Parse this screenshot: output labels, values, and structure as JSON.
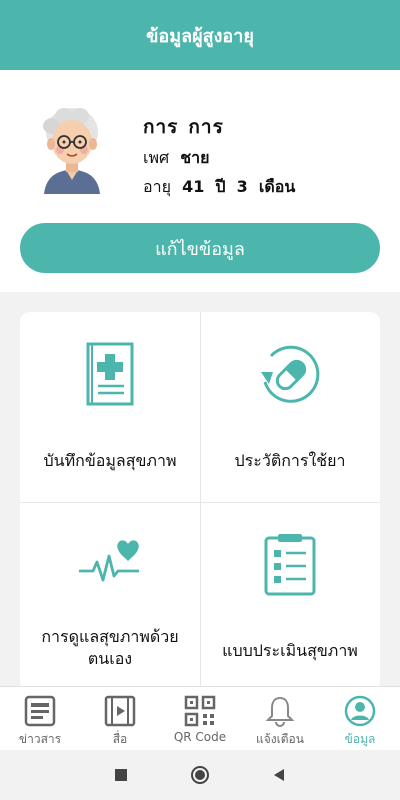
{
  "header": {
    "title": "ข้อมูลผู้สูงอายุ"
  },
  "profile": {
    "first_name": "การ",
    "last_name": "การ",
    "gender_label": "เพศ",
    "gender_value": "ชาย",
    "age_label": "อายุ",
    "age_years": "41",
    "years_unit": "ปี",
    "age_months": "3",
    "months_unit": "เดือน",
    "edit_label": "แก้ไขข้อมูล"
  },
  "menu": [
    {
      "label": "บันทึกข้อมูลสุขภาพ",
      "icon": "medical-record-icon"
    },
    {
      "label": "ประวัติการใช้ยา",
      "icon": "medication-history-icon"
    },
    {
      "label": "การดูแลสุขภาพด้วยตนเอง",
      "icon": "heart-pulse-icon"
    },
    {
      "label": "แบบประเมินสุขภาพ",
      "icon": "clipboard-checklist-icon"
    }
  ],
  "nav": [
    {
      "label": "ข่าวสาร",
      "icon": "news-icon"
    },
    {
      "label": "สื่อ",
      "icon": "media-film-icon"
    },
    {
      "label": "QR Code",
      "icon": "qr-code-icon"
    },
    {
      "label": "แจ้งเตือน",
      "icon": "bell-icon"
    },
    {
      "label": "ข้อมูล",
      "icon": "profile-icon",
      "active": true
    }
  ],
  "colors": {
    "accent": "#4db6ac",
    "header": "#4db6ac"
  }
}
